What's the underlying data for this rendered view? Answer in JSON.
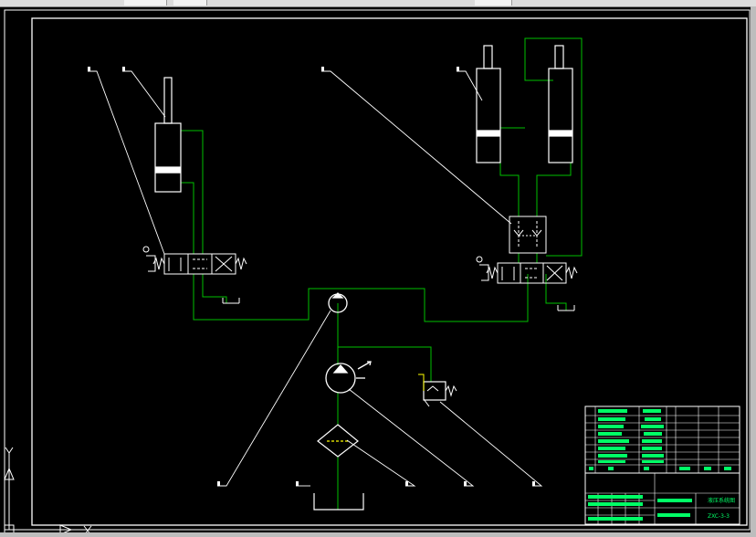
{
  "drawing": {
    "colors": {
      "background": "#000000",
      "line": "#ffffff",
      "pipe": "#00c000",
      "text": "#00ff66",
      "valve_body": "#ffff00"
    },
    "title_block": {
      "drawing_name": "液压系统图",
      "drawing_code": "ZXC-3-3"
    }
  }
}
